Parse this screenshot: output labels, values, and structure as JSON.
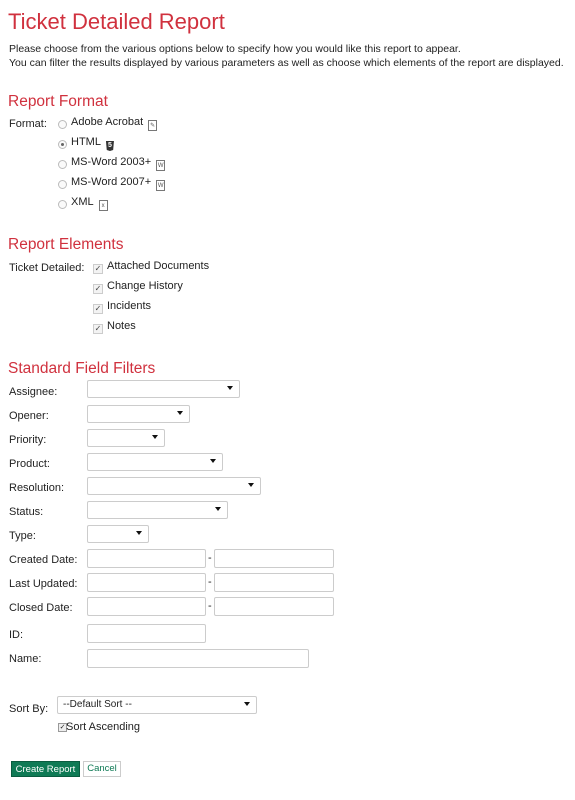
{
  "page": {
    "title": "Ticket Detailed Report",
    "intro_line1": "Please choose from the various options below to specify how you would like this report to appear.",
    "intro_line2": "You can filter the results displayed by various parameters as well as choose which elements of the report are displayed."
  },
  "report_format": {
    "heading": "Report Format",
    "label": "Format:",
    "options": [
      {
        "label": "Adobe Acrobat",
        "icon": "pdf-icon",
        "selected": false
      },
      {
        "label": "HTML",
        "icon": "html5-icon",
        "selected": true
      },
      {
        "label": "MS-Word 2003+",
        "icon": "word-icon",
        "selected": false
      },
      {
        "label": "MS-Word 2007+",
        "icon": "word-icon",
        "selected": false
      },
      {
        "label": "XML",
        "icon": "xml-icon",
        "selected": false
      }
    ]
  },
  "report_elements": {
    "heading": "Report Elements",
    "label": "Ticket Detailed:",
    "items": [
      {
        "label": "Attached Documents",
        "checked": true
      },
      {
        "label": "Change History",
        "checked": true
      },
      {
        "label": "Incidents",
        "checked": true
      },
      {
        "label": "Notes",
        "checked": true
      }
    ]
  },
  "filters": {
    "heading": "Standard Field Filters",
    "assignee": "Assignee:",
    "opener": "Opener:",
    "priority": "Priority:",
    "product": "Product:",
    "resolution": "Resolution:",
    "status": "Status:",
    "type": "Type:",
    "created_date": "Created Date:",
    "last_updated": "Last Updated:",
    "closed_date": "Closed Date:",
    "id": "ID:",
    "name": "Name:",
    "range_sep": "-"
  },
  "sort": {
    "label": "Sort By:",
    "selected": "--Default Sort --",
    "ascending_label": "Sort Ascending",
    "ascending_checked": true
  },
  "actions": {
    "create": "Create Report",
    "cancel": "Cancel"
  },
  "colors": {
    "heading": "#d0313e",
    "primary_button": "#0f7a55"
  }
}
